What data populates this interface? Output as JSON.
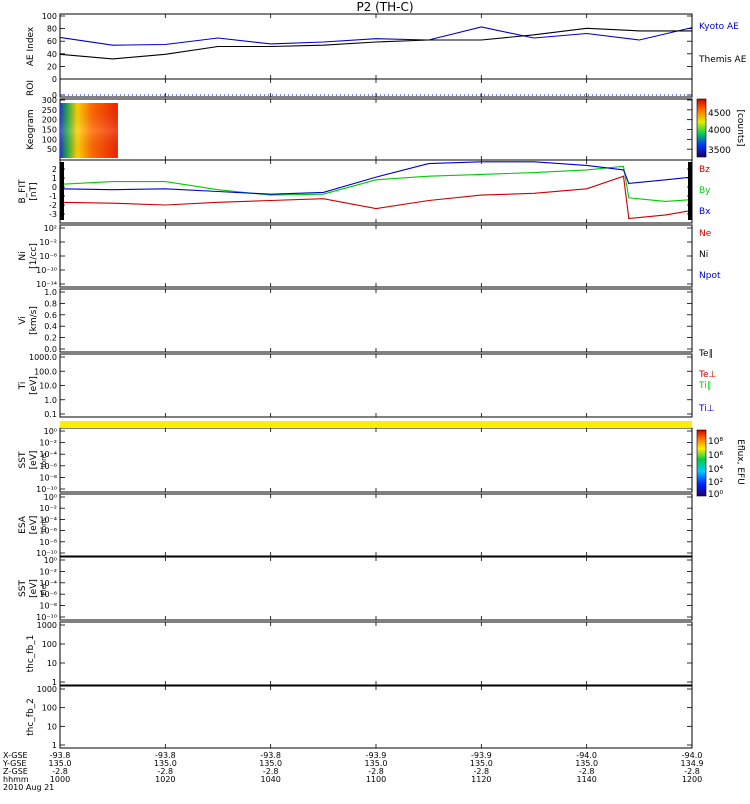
{
  "page": {
    "title": "P2 (TH-C)"
  },
  "x_axis": {
    "ticks": [
      {
        "hhmm": "1000",
        "xgse": "-93.8",
        "ygse": "135.0",
        "zgse": "-2.8"
      },
      {
        "hhmm": "1020",
        "xgse": "-93.8",
        "ygse": "135.0",
        "zgse": "-2.8"
      },
      {
        "hhmm": "1040",
        "xgse": "-93.8",
        "ygse": "135.0",
        "zgse": "-2.8"
      },
      {
        "hhmm": "1100",
        "xgse": "-93.9",
        "ygse": "135.0",
        "zgse": "-2.8"
      },
      {
        "hhmm": "1120",
        "xgse": "-93.9",
        "ygse": "135.0",
        "zgse": "-2.8"
      },
      {
        "hhmm": "1140",
        "xgse": "-94.0",
        "ygse": "135.0",
        "zgse": "-2.8"
      },
      {
        "hhmm": "1200",
        "xgse": "-94.0",
        "ygse": "134.9",
        "zgse": "-2.8"
      }
    ],
    "row_labels": [
      "X-GSE",
      "Y-GSE",
      "Z-GSE",
      "hhmm"
    ],
    "date": "2010 Aug 21"
  },
  "colorbars": {
    "keogram": {
      "ticks": [
        "4500",
        "4000",
        "3500"
      ],
      "label": "[counts]"
    },
    "eflux": {
      "ticks": [
        "10⁸",
        "10⁶",
        "10⁴",
        "10²",
        "10⁰"
      ],
      "label": "Eflux, EFU"
    }
  },
  "chart_data": [
    {
      "type": "line",
      "id": "ae",
      "ylabel": "AE Index",
      "ylim": [
        0,
        100
      ],
      "yticks": [
        "100",
        "80",
        "60",
        "40",
        "20",
        "0"
      ],
      "legend": [
        "Kyoto AE",
        "Themis AE"
      ],
      "colors": {
        "Kyoto AE": "#0000cc",
        "Themis AE": "#000000"
      },
      "x": [
        "10:00",
        "10:10",
        "10:20",
        "10:30",
        "10:40",
        "10:50",
        "11:00",
        "11:10",
        "11:20",
        "11:30",
        "11:40",
        "11:50",
        "12:00"
      ],
      "series": [
        {
          "name": "Kyoto AE",
          "values": [
            64,
            52,
            53,
            63,
            54,
            57,
            62,
            60,
            80,
            63,
            70,
            60,
            79
          ]
        },
        {
          "name": "Themis AE",
          "values": [
            38,
            31,
            38,
            50,
            50,
            52,
            57,
            60,
            60,
            68,
            78,
            74,
            74
          ]
        }
      ]
    },
    {
      "type": "line",
      "id": "roi",
      "ylabel": "ROI",
      "yticks": [
        "0"
      ],
      "values": [
        0
      ]
    },
    {
      "type": "heatmap",
      "id": "keogram",
      "ylabel": "Keogram",
      "ylim": [
        0,
        300
      ],
      "yticks": [
        "300",
        "250",
        "200",
        "150",
        "100",
        "50"
      ],
      "x_range": [
        "10:00",
        "10:11"
      ],
      "zlim": [
        3300,
        4700
      ],
      "zlabel": "[counts]"
    },
    {
      "type": "line",
      "id": "bfield",
      "ylabel": "B_FIT",
      "units": "[nT]",
      "ylim": [
        -4,
        3
      ],
      "yticks": [
        "2",
        "1",
        "0",
        "-1",
        "-2",
        "-3"
      ],
      "legend": [
        "Bz",
        "By",
        "Bx"
      ],
      "colors": {
        "Bz": "#cc0000",
        "By": "#00cc00",
        "Bx": "#0000cc"
      },
      "x": [
        "10:00",
        "10:10",
        "10:20",
        "10:30",
        "10:40",
        "10:50",
        "11:00",
        "11:10",
        "11:20",
        "11:30",
        "11:40",
        "11:47",
        "11:48",
        "11:55",
        "12:00"
      ],
      "series": [
        {
          "name": "Bz",
          "values": [
            -1.7,
            -1.8,
            -2.0,
            -1.7,
            -1.5,
            -1.3,
            -2.4,
            -1.5,
            -0.9,
            -0.7,
            -0.2,
            1.2,
            -3.5,
            -3.1,
            -2.6
          ]
        },
        {
          "name": "By",
          "values": [
            0.3,
            0.6,
            0.6,
            -0.3,
            -0.9,
            -0.8,
            0.8,
            1.2,
            1.4,
            1.6,
            1.9,
            2.3,
            -1.2,
            -1.6,
            -1.4
          ]
        },
        {
          "name": "Bx",
          "values": [
            -0.2,
            -0.3,
            -0.2,
            -0.5,
            -0.8,
            -0.6,
            1.1,
            2.6,
            2.8,
            2.8,
            2.4,
            1.9,
            0.4,
            0.8,
            1.1
          ]
        }
      ]
    },
    {
      "type": "line",
      "id": "ni",
      "ylabel": "Ni",
      "units": "[1/cc]",
      "yticks": [
        "10²",
        "10⁻²",
        "10⁻⁶",
        "10⁻¹⁰",
        "10⁻¹⁴"
      ],
      "legend": [
        "Ne",
        "Ni",
        "Npot"
      ],
      "colors": {
        "Ne": "#cc0000",
        "Ni": "#000000",
        "Npot": "#0000cc"
      },
      "series": []
    },
    {
      "type": "line",
      "id": "vi",
      "ylabel": "Vi",
      "units": "[km/s]",
      "ylim": [
        0,
        1
      ],
      "yticks": [
        "1.0",
        "0.8",
        "0.6",
        "0.4",
        "0.2",
        "0.0"
      ],
      "series": []
    },
    {
      "type": "line",
      "id": "ti",
      "ylabel": "Ti",
      "units": "[eV]",
      "scale": "log",
      "yticks": [
        "1000.0",
        "100.0",
        "10.0",
        "1.0",
        "0.1"
      ],
      "legend": [
        "Te∥",
        "Te⊥",
        "Ti∥",
        "Ti⊥"
      ],
      "colors": {
        "Te∥": "#000000",
        "Te⊥": "#cc0000",
        "Ti∥": "#00cc00",
        "Ti⊥": "#0000cc"
      },
      "series": []
    },
    {
      "type": "line",
      "id": "sst_ion",
      "ylabel": "SST",
      "units": "[eV]",
      "sublabel": "Ions",
      "yticks": [
        "10⁰",
        "10⁻²",
        "10⁻⁴",
        "10⁻⁶",
        "10⁻⁸",
        "10⁻¹⁰"
      ],
      "series": []
    },
    {
      "type": "line",
      "id": "esa_ion",
      "ylabel": "ESA",
      "units": "[eV]",
      "sublabel": "Ions",
      "yticks": [
        "10⁰",
        "10⁻²",
        "10⁻⁴",
        "10⁻⁶",
        "10⁻⁸",
        "10⁻¹⁰"
      ],
      "series": []
    },
    {
      "type": "line",
      "id": "sst_elec",
      "ylabel": "SST",
      "units": "[eV]",
      "sublabel": "Elec",
      "yticks": [
        "10⁰",
        "10⁻²",
        "10⁻⁴",
        "10⁻⁶",
        "10⁻⁸",
        "10⁻¹⁰"
      ],
      "series": []
    },
    {
      "type": "line",
      "id": "fb1",
      "ylabel": "thc_fb_1",
      "scale": "log",
      "ylim": [
        1,
        1000
      ],
      "yticks": [
        "1000",
        "100",
        "10",
        "1"
      ],
      "series": []
    },
    {
      "type": "line",
      "id": "fb2",
      "ylabel": "thc_fb_2",
      "scale": "log",
      "ylim": [
        1,
        1000
      ],
      "yticks": [
        "1000",
        "100",
        "10",
        "1"
      ],
      "series": []
    }
  ]
}
